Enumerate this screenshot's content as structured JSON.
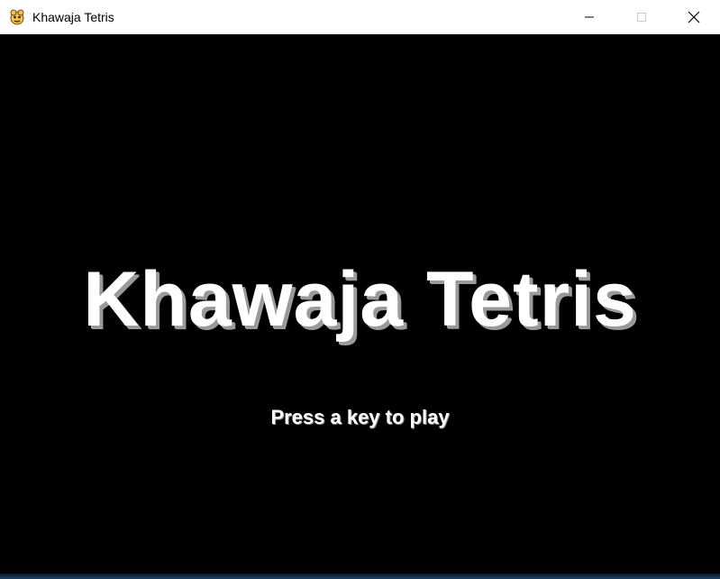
{
  "window": {
    "title": "Khawaja Tetris",
    "icon": "pygame-snake-icon",
    "controls": [
      "minimize",
      "maximize",
      "close"
    ]
  },
  "game": {
    "title": "Khawaja Tetris",
    "prompt": "Press a key to play",
    "background_color": "#000000",
    "text_color": "#ffffff",
    "shadow_color": "#9a9a9a"
  }
}
